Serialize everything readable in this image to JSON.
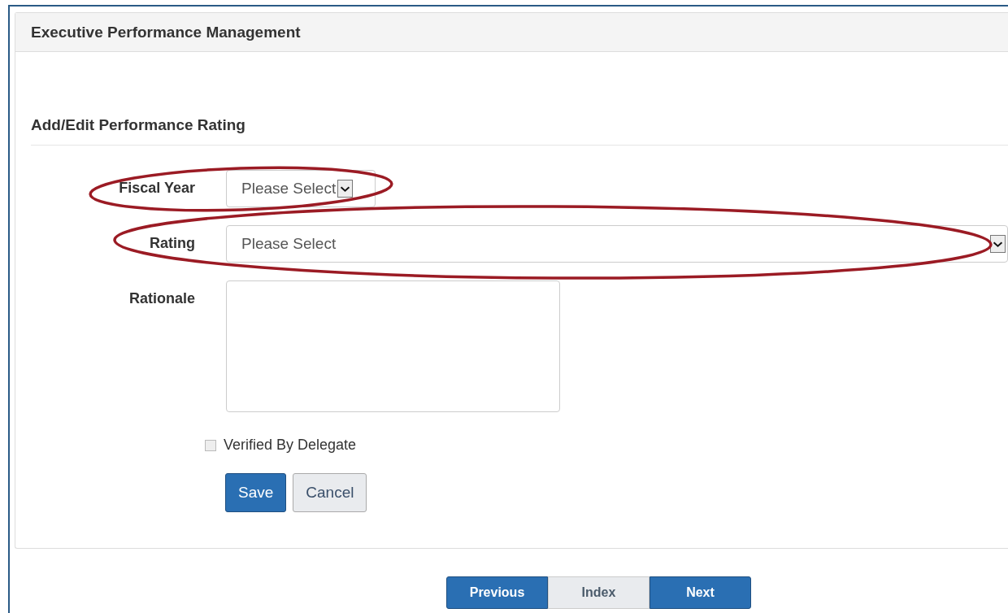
{
  "panel": {
    "title": "Executive Performance Management"
  },
  "form": {
    "heading": "Add/Edit Performance Rating",
    "fields": [
      {
        "kind": "select",
        "label": "Fiscal Year",
        "placeholder": "Please Select",
        "wide": false,
        "highlighted": true
      },
      {
        "kind": "select",
        "label": "Rating",
        "placeholder": "Please Select",
        "wide": true,
        "highlighted": true
      },
      {
        "kind": "textarea",
        "label": "Rationale",
        "highlighted": false
      }
    ],
    "checkbox": {
      "label": "Verified By Delegate",
      "checked": false
    },
    "buttons": [
      {
        "label": "Save",
        "kind": "primary"
      },
      {
        "label": "Cancel",
        "kind": "default"
      }
    ]
  },
  "pager": [
    {
      "label": "Previous",
      "selected": false
    },
    {
      "label": "Index",
      "selected": true
    },
    {
      "label": "Next",
      "selected": false
    }
  ]
}
